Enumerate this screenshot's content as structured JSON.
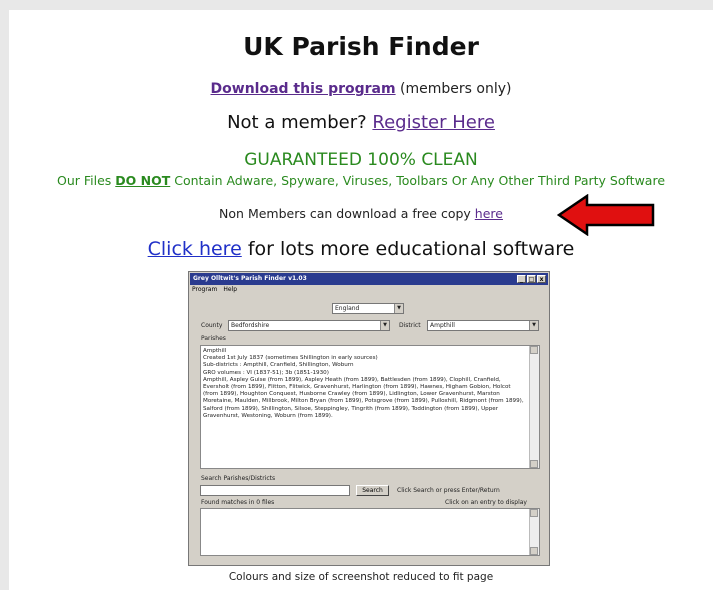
{
  "title": "UK Parish Finder",
  "download": {
    "link": "Download this program",
    "note": "(members only)"
  },
  "member": {
    "prefix": "Not a member?",
    "link": "Register Here"
  },
  "guarantee": "GUARANTEED 100% CLEAN",
  "clean": {
    "prefix": "Our Files",
    "emph": "DO NOT",
    "suffix": "Contain Adware, Spyware, Viruses, Toolbars Or Any Other Third Party Software"
  },
  "nonmembers": {
    "text": "Non Members can download a free copy",
    "link": "here"
  },
  "edu": {
    "link": "Click here",
    "suffix": "for lots more educational software"
  },
  "caption": "Colours and size of screenshot reduced to fit page",
  "app": {
    "title": "Grey Olltwit's Parish Finder v1.03",
    "menu": [
      "Program",
      "Help"
    ],
    "country": "England",
    "county_label": "County",
    "county": "Bedfordshire",
    "district_label": "District",
    "district": "Ampthill",
    "parishes_label": "Parishes",
    "parishes_text": "Ampthill\nCreated 1st July 1837 (sometimes Shillington in early sources)\nSub-districts : Ampthill, Cranfield, Shillington, Woburn\nGRO volumes : VI (1837-51); 3b (1851-1930)\nAmpthill, Aspley Guise (from 1899), Aspley Heath (from 1899), Battlesden (from 1899), Clophill, Cranfield, Eversholt (from 1899), Flitton, Flitwick, Gravenhurst, Harlington (from 1899), Hawnes, Higham Gobion, Holcot (from 1899), Houghton Conquest, Husborne Crawley (from 1899), Lidlington, Lower Gravenhurst, Marston Moretaine, Maulden, Millbrook, Milton Bryan (from 1899), Potsgrove (from 1899), Pulloxhill, Ridgmont (from 1899), Salford (from 1899), Shillington, Silsoe, Steppingley, Tingrith (from 1899), Toddington (from 1899), Upper Gravenhurst, Westoning, Woburn (from 1899).",
    "search_label": "Search Parishes/Districts",
    "search_button": "Search",
    "search_hint": "Click Search or press Enter/Return",
    "found": "Found matches in 0 files",
    "click_hint": "Click on an entry to display",
    "window_buttons": [
      "_",
      "□",
      "x"
    ]
  },
  "accent": {
    "purple": "#5a2b8c",
    "green": "#2a8a1f",
    "blue": "#2030c8",
    "arrow": "#e01010"
  }
}
